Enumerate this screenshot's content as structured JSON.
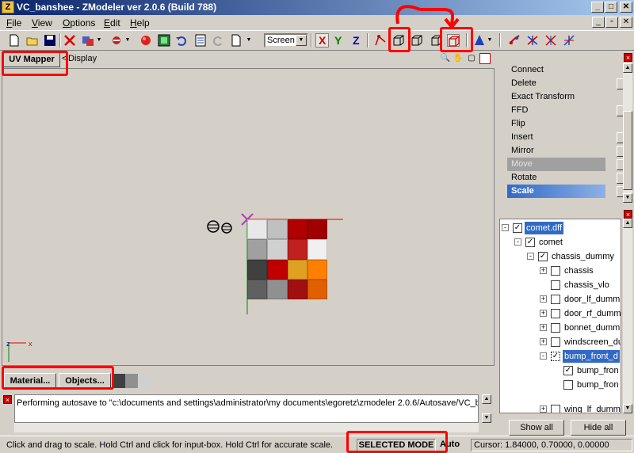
{
  "window": {
    "app_icon": "Z",
    "title": "VC_banshee - ZModeler ver 2.0.6 (Build 788)",
    "minimize": "_",
    "maximize": "□",
    "close": "✕"
  },
  "menu": {
    "items": [
      "File",
      "View",
      "Options",
      "Edit",
      "Help"
    ],
    "mdi_min": "_",
    "mdi_restore": "▫",
    "mdi_close": "✕"
  },
  "toolbar": {
    "screen_select": "Screen",
    "axes": [
      "X",
      "Y",
      "Z"
    ],
    "icons": [
      "new-icon",
      "open-icon",
      "save-icon",
      "delete-icon",
      "copy-icon",
      "settings-icon",
      "sphere-icon",
      "image-icon",
      "undo-icon",
      "document-icon",
      "redo-icon",
      "page-icon",
      "vertex-mode-icon",
      "box-mode-icon",
      "poly-mode-icon",
      "box-mode-2-icon",
      "selected-mode-icon",
      "cone-icon",
      "tool-a-icon",
      "tool-b-icon",
      "tool-c-icon",
      "tool-d-icon"
    ]
  },
  "view": {
    "uv_mapper_tab": "UV Mapper",
    "display_tab": "Display",
    "arrow": "<",
    "materials_button": "Material...",
    "objects_button": "Objects..."
  },
  "log": {
    "text": "Performing autosave to \"c:\\documents and settings\\administrator\\my documents\\egoretz\\zmodeler 2.0.6/Autosave/VC_b"
  },
  "status": {
    "hint": "Click and drag to scale. Hold Ctrl and click for input-box. Hold Ctrl for accurate scale.",
    "mode": "SELECTED MODE",
    "auto": "Auto",
    "cursor": "Cursor: 1.84000, 0.70000, 0.00000"
  },
  "commands": {
    "items": [
      {
        "label": "Connect",
        "option": false,
        "state": "normal"
      },
      {
        "label": "Delete",
        "option": true,
        "state": "normal"
      },
      {
        "label": "Exact Transform",
        "option": false,
        "state": "normal"
      },
      {
        "label": "FFD",
        "option": true,
        "state": "normal"
      },
      {
        "label": "Flip",
        "option": false,
        "state": "normal"
      },
      {
        "label": "Insert",
        "option": true,
        "state": "normal"
      },
      {
        "label": "Mirror",
        "option": true,
        "state": "normal"
      },
      {
        "label": "Move",
        "option": true,
        "state": "disabled"
      },
      {
        "label": "Rotate",
        "option": true,
        "state": "normal"
      },
      {
        "label": "Scale",
        "option": true,
        "state": "selected"
      }
    ]
  },
  "tree": {
    "nodes": [
      {
        "label": "comet.dff",
        "expander": "-",
        "checked": true
      },
      {
        "label": "comet",
        "expander": "-",
        "checked": true
      },
      {
        "label": "chassis_dummy",
        "expander": "-",
        "checked": true
      },
      {
        "label": "chassis",
        "expander": "+",
        "checked": false
      },
      {
        "label": "chassis_vlo",
        "expander": "",
        "checked": false
      },
      {
        "label": "door_lf_dumm",
        "expander": "+",
        "checked": false
      },
      {
        "label": "door_rf_dumm",
        "expander": "+",
        "checked": false
      },
      {
        "label": "bonnet_dumm",
        "expander": "+",
        "checked": false
      },
      {
        "label": "windscreen_du",
        "expander": "+",
        "checked": false
      },
      {
        "label": "bump_front_d",
        "expander": "-",
        "checked": true
      },
      {
        "label": "bump_fron",
        "expander": "",
        "checked": true
      },
      {
        "label": "bump_fron",
        "expander": "",
        "checked": false
      },
      {
        "label": "wing_lf_dumm",
        "expander": "+",
        "checked": false
      }
    ],
    "show_all": "Show all",
    "hide_all": "Hide all"
  },
  "colors": {
    "selection": "#316ac5",
    "highlight": "#ff0000"
  }
}
